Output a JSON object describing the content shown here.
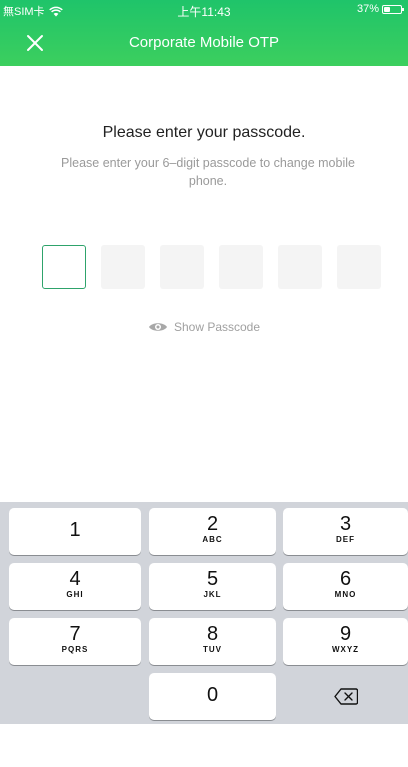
{
  "status_bar": {
    "carrier": "無SIM卡",
    "time": "上午11:43",
    "battery": "37%",
    "battery_level": 0.37
  },
  "nav": {
    "title": "Corporate Mobile OTP",
    "close_icon": "close-icon"
  },
  "prompt": {
    "heading": "Please enter your passcode.",
    "subtext": "Please enter your 6–digit passcode to change mobile phone."
  },
  "passcode": {
    "length": 6,
    "active_index": 0,
    "filled": []
  },
  "show_passcode": {
    "label": "Show Passcode",
    "icon": "eye-icon"
  },
  "keypad": {
    "keys": [
      {
        "num": "1",
        "letters": ""
      },
      {
        "num": "2",
        "letters": "ABC"
      },
      {
        "num": "3",
        "letters": "DEF"
      },
      {
        "num": "4",
        "letters": "GHI"
      },
      {
        "num": "5",
        "letters": "JKL"
      },
      {
        "num": "6",
        "letters": "MNO"
      },
      {
        "num": "7",
        "letters": "PQRS"
      },
      {
        "num": "8",
        "letters": "TUV"
      },
      {
        "num": "9",
        "letters": "WXYZ"
      },
      {
        "num": "0",
        "letters": ""
      }
    ],
    "backspace_icon": "backspace-icon"
  },
  "colors": {
    "header": "#1fc46a",
    "active_border": "#2ea36b",
    "keypad_bg": "#d1d4da"
  }
}
